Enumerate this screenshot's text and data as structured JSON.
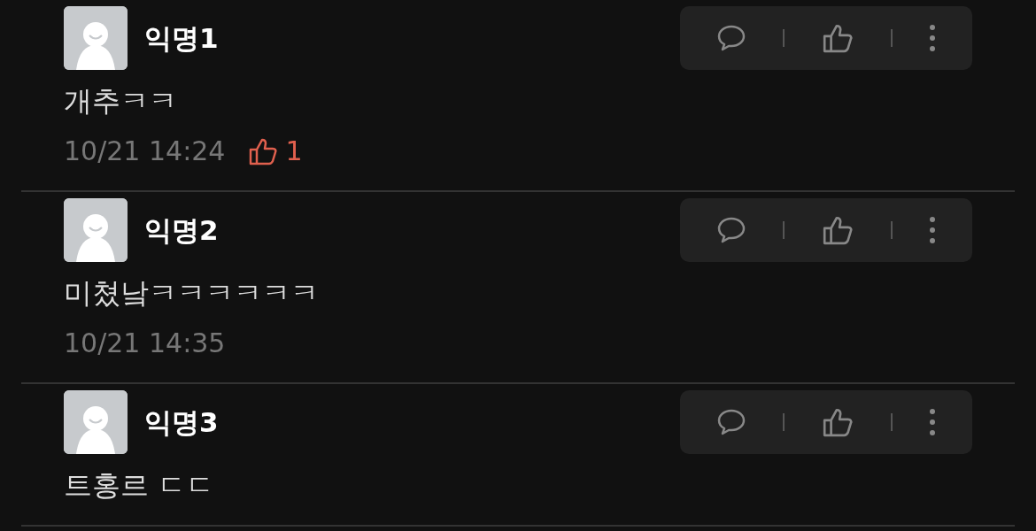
{
  "comments": [
    {
      "name": "익명1",
      "text": "개추ㅋㅋ",
      "time": "10/21 14:24",
      "likes": "1"
    },
    {
      "name": "익명2",
      "text": "미쳤낰ㅋㅋㅋㅋㅋㅋ",
      "time": "10/21 14:35"
    },
    {
      "name": "익명3",
      "text": "트홍르 ㄷㄷ"
    }
  ]
}
